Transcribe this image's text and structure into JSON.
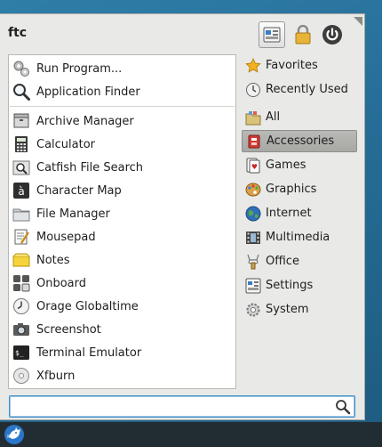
{
  "user": {
    "name": "ftc"
  },
  "header_buttons": [
    {
      "name": "settings-manager-icon",
      "active": true
    },
    {
      "name": "lock-icon",
      "active": false
    },
    {
      "name": "power-icon",
      "active": false
    }
  ],
  "apps": {
    "top": [
      {
        "label": "Run Program...",
        "icon": "gears-icon"
      },
      {
        "label": "Application Finder",
        "icon": "magnifier-icon"
      }
    ],
    "items": [
      {
        "label": "Archive Manager",
        "icon": "archive-icon"
      },
      {
        "label": "Calculator",
        "icon": "calculator-icon"
      },
      {
        "label": "Catfish File Search",
        "icon": "file-search-icon"
      },
      {
        "label": "Character Map",
        "icon": "character-map-icon"
      },
      {
        "label": "File Manager",
        "icon": "folder-icon"
      },
      {
        "label": "Mousepad",
        "icon": "text-editor-icon"
      },
      {
        "label": "Notes",
        "icon": "notes-icon"
      },
      {
        "label": "Onboard",
        "icon": "keyboard-icon"
      },
      {
        "label": "Orage Globaltime",
        "icon": "clock-icon"
      },
      {
        "label": "Screenshot",
        "icon": "screenshot-icon"
      },
      {
        "label": "Terminal Emulator",
        "icon": "terminal-icon"
      },
      {
        "label": "Xfburn",
        "icon": "disc-icon"
      }
    ]
  },
  "categories": [
    {
      "label": "Favorites",
      "icon": "star-icon"
    },
    {
      "label": "Recently Used",
      "icon": "history-icon"
    },
    {
      "label": "All",
      "icon": "all-apps-icon"
    },
    {
      "label": "Accessories",
      "icon": "accessories-icon",
      "selected": true
    },
    {
      "label": "Games",
      "icon": "games-icon"
    },
    {
      "label": "Graphics",
      "icon": "graphics-icon"
    },
    {
      "label": "Internet",
      "icon": "globe-icon"
    },
    {
      "label": "Multimedia",
      "icon": "multimedia-icon"
    },
    {
      "label": "Office",
      "icon": "office-icon"
    },
    {
      "label": "Settings",
      "icon": "settings-icon"
    },
    {
      "label": "System",
      "icon": "system-gear-icon"
    }
  ],
  "search": {
    "placeholder": "",
    "value": ""
  },
  "colors": {
    "desktop": "#2a76a0",
    "menu_bg": "#e9e9e7",
    "selection": "#adadaa",
    "search_focus": "#3d8ec9",
    "panel": "#222d33"
  }
}
